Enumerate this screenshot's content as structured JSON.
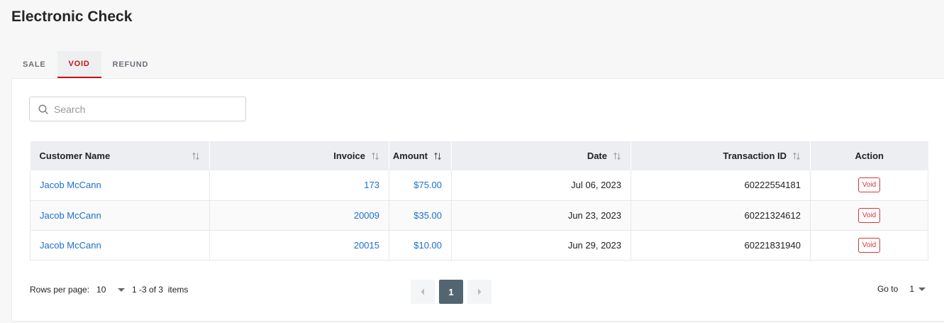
{
  "page": {
    "title": "Electronic Check"
  },
  "tabs": [
    {
      "label": "SALE",
      "active": false
    },
    {
      "label": "VOID",
      "active": true
    },
    {
      "label": "REFUND",
      "active": false
    }
  ],
  "search": {
    "placeholder": "Search",
    "value": ""
  },
  "table": {
    "columns": [
      "Customer Name",
      "Invoice",
      "Amount",
      "Date",
      "Transaction ID",
      "Action"
    ],
    "rows": [
      {
        "customer": "Jacob McCann",
        "invoice": "173",
        "amount": "$75.00",
        "date": "Jul 06, 2023",
        "transaction_id": "60222554181",
        "action": "Void"
      },
      {
        "customer": "Jacob McCann",
        "invoice": "20009",
        "amount": "$35.00",
        "date": "Jun 23, 2023",
        "transaction_id": "60221324612",
        "action": "Void"
      },
      {
        "customer": "Jacob McCann",
        "invoice": "20015",
        "amount": "$10.00",
        "date": "Jun 29, 2023",
        "transaction_id": "60221831940",
        "action": "Void"
      }
    ]
  },
  "footer": {
    "rows_per_page_label": "Rows per page:",
    "rows_per_page_value": "10",
    "range_text": "1 -3 of 3  items",
    "current_page": "1",
    "goto_label": "Go to",
    "goto_value": "1"
  },
  "colors": {
    "accent": "#c0141b",
    "link": "#1a6fcf",
    "pager_active": "#536571"
  },
  "icons": {
    "search": "search-icon",
    "sort": "sort-icon",
    "prev": "chevron-left-icon",
    "next": "chevron-right-icon",
    "dropdown": "caret-down-icon"
  }
}
